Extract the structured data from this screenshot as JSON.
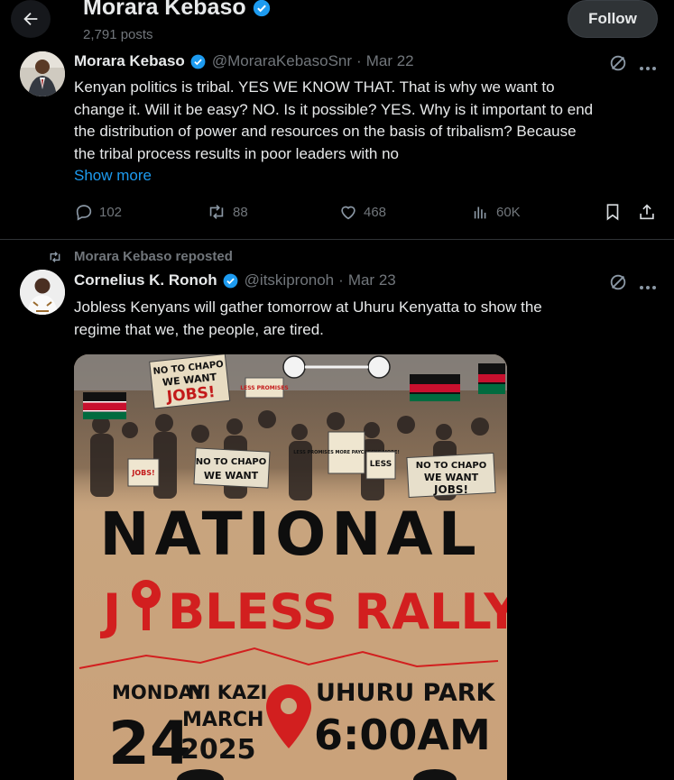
{
  "header": {
    "title": "Morara Kebaso",
    "posts": "2,791 posts",
    "follow_label": "Follow"
  },
  "tweet1": {
    "name": "Morara Kebaso",
    "handle": "@MoraraKebasoSnr",
    "date": "Mar 22",
    "text_lines": [
      "Kenyan politics is tribal. YES WE KNOW THAT. That is why we want to",
      "change it. Will it be easy? NO. Is it possible? YES. Why is it important to end",
      "the distribution of power and resources on the basis of tribalism? Because",
      "the tribal process results in poor leaders with no"
    ],
    "show_more": "Show more",
    "replies": "102",
    "reposts": "88",
    "likes": "468",
    "views": "60K"
  },
  "tweet2": {
    "repost_label": "Morara Kebaso reposted",
    "name": "Cornelius K. Ronoh",
    "handle": "@itskipronoh",
    "date": "Mar 23",
    "text_lines": [
      "Jobless Kenyans will gather tomorrow at Uhuru Kenyatta to show the",
      "regime that we, the people, are tired."
    ],
    "poster": {
      "signs": [
        "NO TO CHAPO",
        "WE WANT",
        "JOBS!",
        "LESS PROMISES",
        "NO TO CHAPO",
        "WE WANT",
        "JOBS!",
        "NO TO CHAPO",
        "WE WANT",
        "JOBS!",
        "LESS PROMISES MORE PAYCHECKS MORE!",
        "LESS",
        "JOBS!",
        "MORE"
      ],
      "headline": "NATIONAL",
      "subhead_prefix": "J",
      "subhead_rest": "BLESS RALLY",
      "day": "MONDAY",
      "ni_kazi": "NI KAZI",
      "date_num": "24",
      "month": "MARCH",
      "year": "2025",
      "venue": "UHURU PARK",
      "time": "6:00AM"
    }
  },
  "colors": {
    "accent": "#1d9bf0",
    "muted": "#71767b",
    "poster_red": "#d21f1f"
  }
}
